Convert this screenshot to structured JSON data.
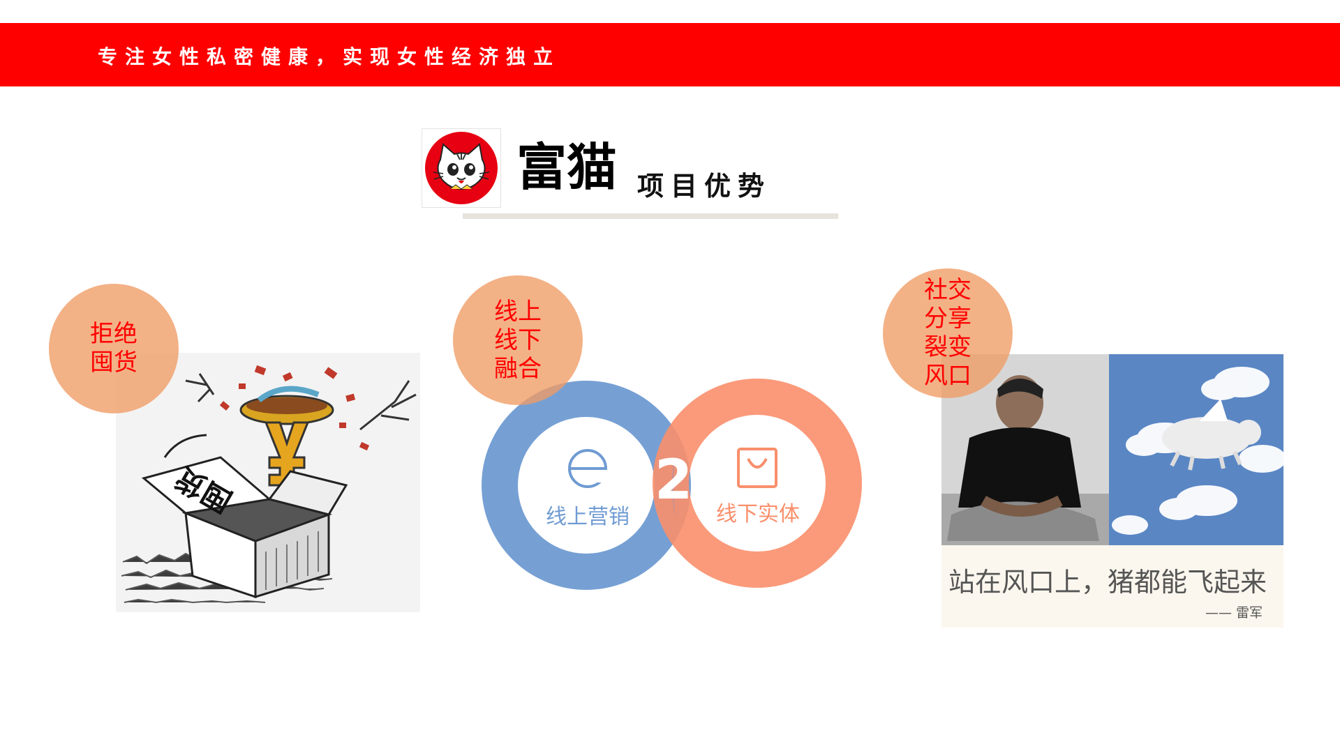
{
  "banner": {
    "slogan": "专注女性私密健康，实现女性经济独立",
    "color": "#ff0000"
  },
  "title": {
    "brand": "富猫",
    "subtitle": "项目优势",
    "logo_icon": "cat-face-logo"
  },
  "panels": [
    {
      "bubble_text": "拒绝\n囤货",
      "image": "money-sign-bursting-from-hoarded-goods-box",
      "box_label": "囤货"
    },
    {
      "bubble_text": "线上\n线下\n融合",
      "diagram": {
        "online_label": "线上营销",
        "offline_label": "线下实体",
        "center_label": "2",
        "online_icon": "e-icon",
        "offline_icon": "shopping-bag-icon",
        "online_color": "#6f9bd2",
        "offline_color": "#f98f6c"
      }
    },
    {
      "bubble_text": "社交\n分享\n裂变\n风口",
      "image": "seated-man-and-flying-pig-in-clouds",
      "quote": "站在风口上，猪都能飞起来",
      "author": "—— 雷军"
    }
  ],
  "colors": {
    "bubble": "#f09b64",
    "bubble_text": "#ff0000",
    "rule": "#e7e3dc"
  }
}
